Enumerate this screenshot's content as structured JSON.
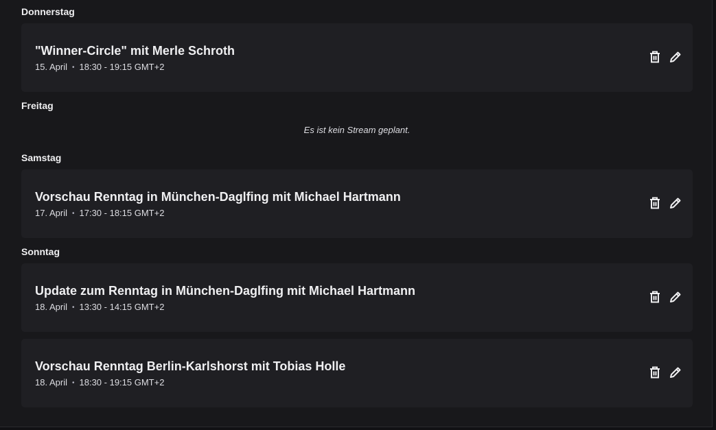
{
  "schedule": {
    "days": [
      {
        "name": "Donnerstag",
        "empty_text": null,
        "streams": [
          {
            "title": "\"Winner-Circle\" mit Merle Schroth",
            "date": "15. April",
            "time": "18:30 - 19:15 GMT+2"
          }
        ]
      },
      {
        "name": "Freitag",
        "empty_text": "Es ist kein Stream geplant.",
        "streams": []
      },
      {
        "name": "Samstag",
        "empty_text": null,
        "streams": [
          {
            "title": "Vorschau Renntag in München-Daglfing mit Michael Hartmann",
            "date": "17. April",
            "time": "17:30 - 18:15 GMT+2"
          }
        ]
      },
      {
        "name": "Sonntag",
        "empty_text": null,
        "streams": [
          {
            "title": "Update zum Renntag in München-Daglfing mit Michael Hartmann",
            "date": "18. April",
            "time": "13:30 - 14:15 GMT+2"
          },
          {
            "title": "Vorschau Renntag Berlin-Karlshorst mit Tobias Holle",
            "date": "18. April",
            "time": "18:30 - 19:15 GMT+2"
          }
        ]
      }
    ],
    "separator": "•",
    "icons": {
      "delete": "trash-icon",
      "edit": "pencil-icon"
    }
  }
}
